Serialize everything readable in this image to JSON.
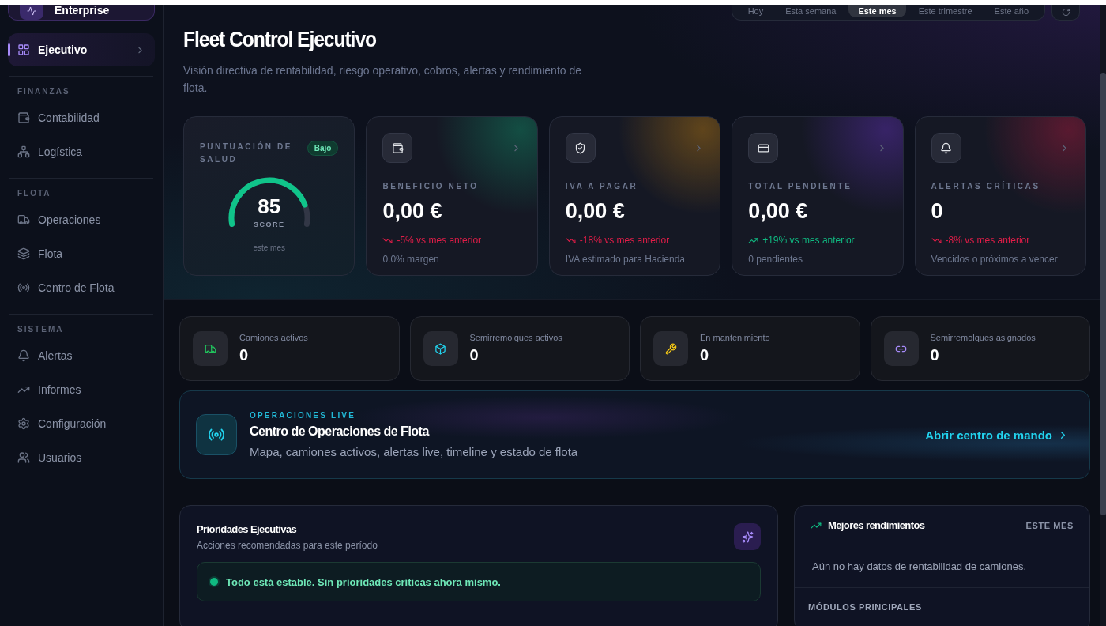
{
  "sidebar": {
    "brand": {
      "name": "Enterprise"
    },
    "items": [
      {
        "label": "Ejecutivo",
        "selected": true
      }
    ],
    "sections": [
      {
        "title": "FINANZAS",
        "items": [
          {
            "label": "Contabilidad",
            "selected": false
          },
          {
            "label": "Logística",
            "selected": false
          }
        ]
      },
      {
        "title": "FLOTA",
        "items": [
          {
            "label": "Operaciones",
            "selected": false
          },
          {
            "label": "Flota",
            "selected": false
          },
          {
            "label": "Centro de Flota",
            "selected": false
          }
        ]
      },
      {
        "title": "SISTEMA",
        "items": [
          {
            "label": "Alertas",
            "selected": false
          },
          {
            "label": "Informes",
            "selected": false
          },
          {
            "label": "Configuración",
            "selected": false
          },
          {
            "label": "Usuarios",
            "selected": false
          }
        ]
      }
    ]
  },
  "period_tabs": [
    {
      "label": "Hoy",
      "selected": false
    },
    {
      "label": "Esta semana",
      "selected": false
    },
    {
      "label": "Este mes",
      "selected": true
    },
    {
      "label": "Este trimestre",
      "selected": false
    },
    {
      "label": "Este año",
      "selected": false
    }
  ],
  "header": {
    "title": "Fleet Control Ejecutivo",
    "subtitle": "Visión directiva de rentabilidad, riesgo operativo, cobros, alertas y rendimiento de flota."
  },
  "health": {
    "title": "PUNTUACIÓN DE SALUD",
    "badge": "Bajo",
    "score": "85",
    "score_label": "SCORE",
    "caption": "este mes"
  },
  "kpis": [
    {
      "label": "BENEFICIO NETO",
      "value": "0,00 €",
      "trend": "-5% vs mes anterior",
      "rising": false,
      "note": "0.0% margen"
    },
    {
      "label": "IVA A PAGAR",
      "value": "0,00 €",
      "trend": "-18% vs mes anterior",
      "rising": false,
      "note": "IVA estimado para Hacienda"
    },
    {
      "label": "TOTAL PENDIENTE",
      "value": "0,00 €",
      "trend": "+19% vs mes anterior",
      "rising": true,
      "note": "0 pendientes"
    },
    {
      "label": "ALERTAS CRÍTICAS",
      "value": "0",
      "trend": "-8% vs mes anterior",
      "rising": false,
      "note": "Vencidos o próximos a vencer"
    }
  ],
  "fleet_counters": [
    {
      "label": "Camiones activos",
      "value": "0"
    },
    {
      "label": "Semirremolques activos",
      "value": "0"
    },
    {
      "label": "En mantenimiento",
      "value": "0"
    },
    {
      "label": "Semirremolques asignados",
      "value": "0"
    }
  ],
  "live_banner": {
    "eyebrow": "OPERACIONES LIVE",
    "title": "Centro de Operaciones de Flota",
    "description": "Mapa, camiones activos, alertas live, timeline y estado de flota",
    "link": "Abrir centro de mando"
  },
  "priorities": {
    "title": "Prioridades Ejecutivas",
    "subtitle": "Acciones recomendadas para este período",
    "status": "Todo está estable. Sin prioridades críticas ahora mismo."
  },
  "best_performers": {
    "title": "Mejores rendimientos",
    "period": "ESTE MES",
    "empty": "Aún no hay datos de rentabilidad de camiones.",
    "modules_title": "MÓDULOS PRINCIPALES"
  }
}
